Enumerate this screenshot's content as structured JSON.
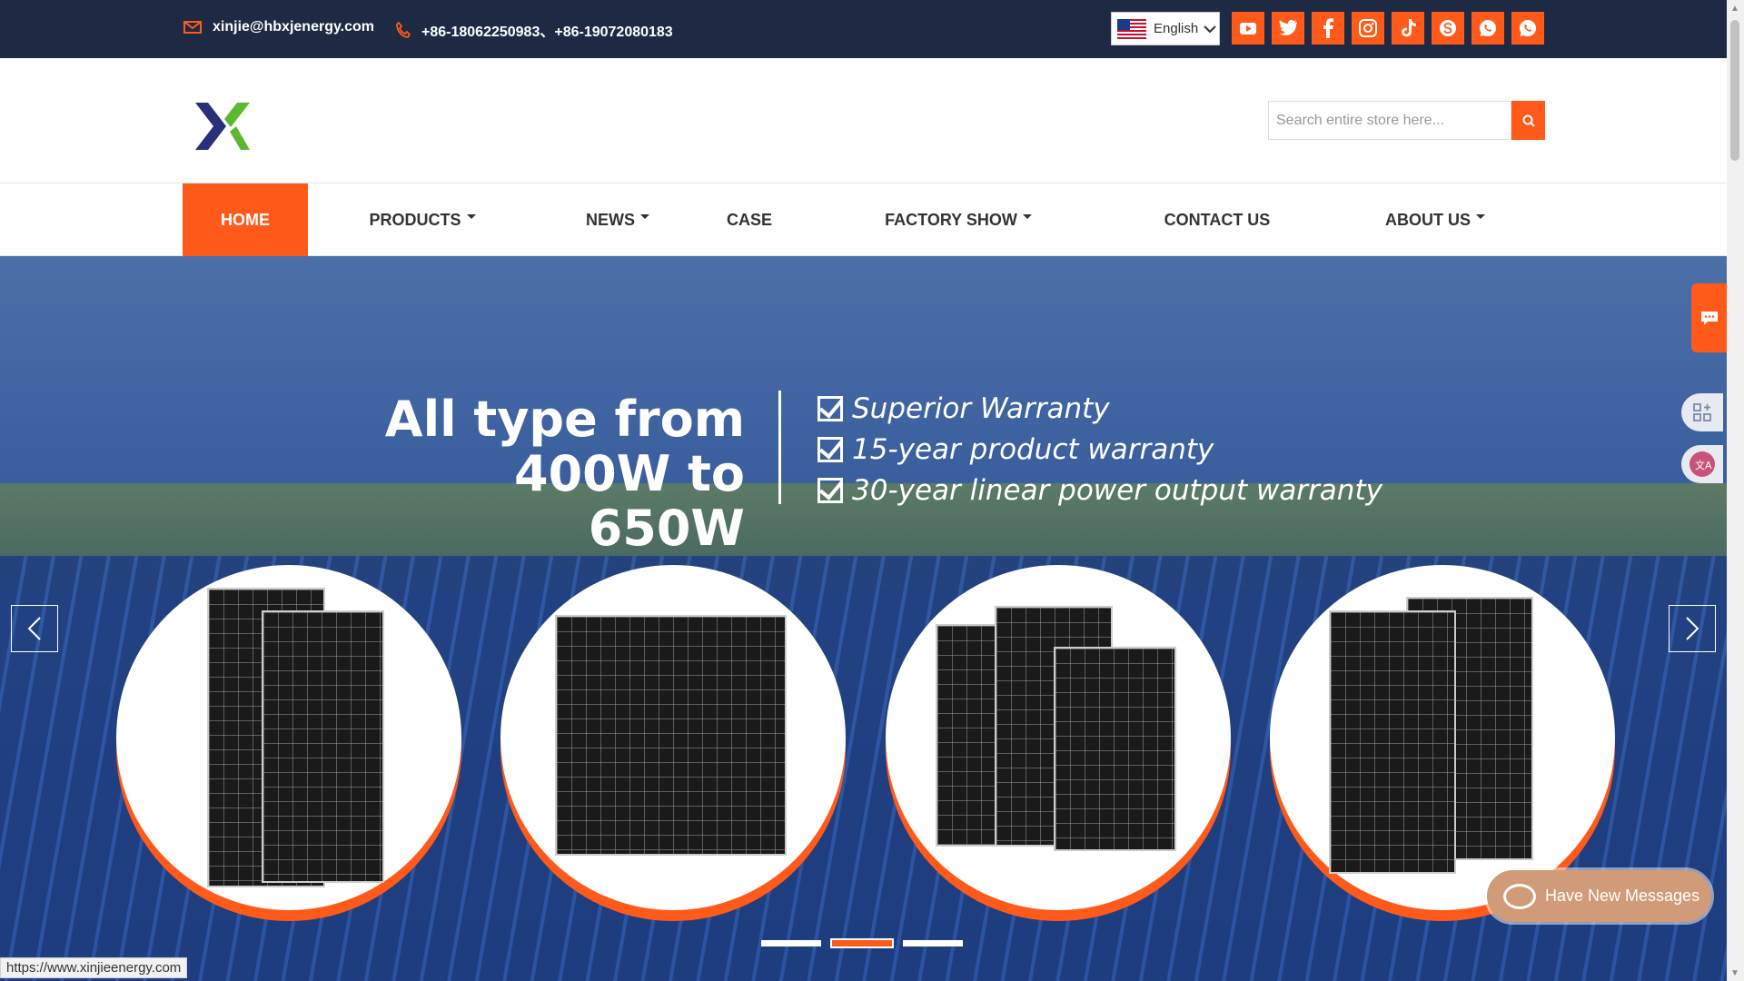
{
  "topbar": {
    "email": "xinjie@hbxjenergy.com",
    "phones": "+86-18062250983、+86-19072080183",
    "language": "English",
    "social_icons": [
      "youtube-icon",
      "twitter-icon",
      "facebook-icon",
      "instagram-icon",
      "tiktok-icon",
      "skype-icon",
      "whatsapp-icon",
      "whatsapp-icon"
    ]
  },
  "header": {
    "search_placeholder": "Search entire store here..."
  },
  "nav": {
    "items": [
      {
        "label": "HOME",
        "active": true
      },
      {
        "label": "PRODUCTS",
        "dropdown": true
      },
      {
        "label": "NEWS",
        "dropdown": true
      },
      {
        "label": "CASE"
      },
      {
        "label": "FACTORY SHOW",
        "dropdown": true
      },
      {
        "label": "CONTACT US"
      },
      {
        "label": "ABOUT US",
        "dropdown": true
      }
    ]
  },
  "hero": {
    "headline_1": "All type from",
    "headline_2": "400W to 650W",
    "warranty": [
      "Superior Warranty",
      "15-year product warranty",
      "30-year linear power output warranty"
    ],
    "active_slide": 2,
    "slide_count": 3
  },
  "widgets": {
    "messages": "Have New Messages"
  },
  "status_bar": {
    "url": "https://www.xinjieenergy.com"
  },
  "colors": {
    "accent": "#ff5a1a",
    "topbar": "#1e2a44"
  }
}
